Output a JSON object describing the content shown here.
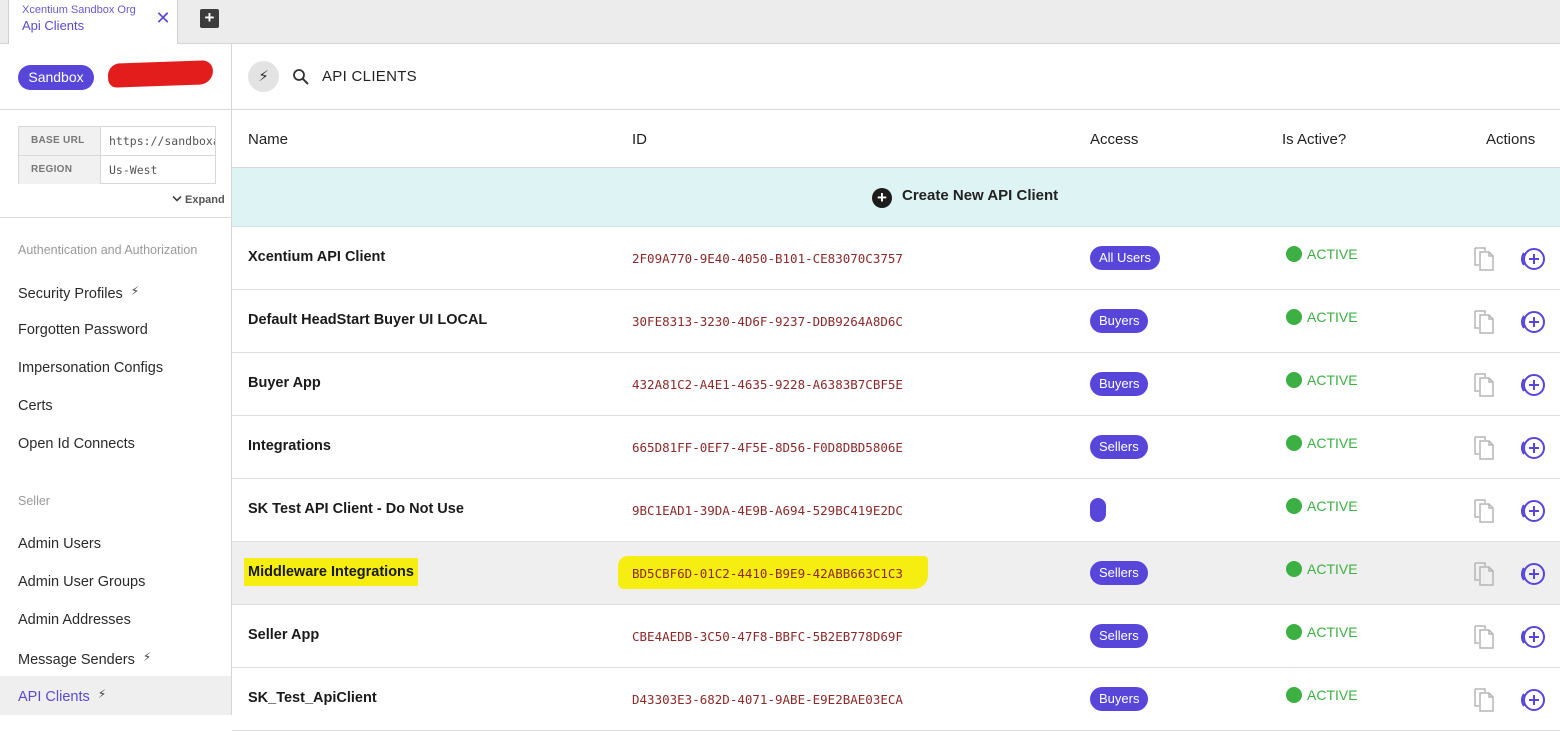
{
  "tab": {
    "org": "Xcentium Sandbox Org",
    "title": "Api Clients",
    "close_glyph": "✕",
    "add_glyph": "+"
  },
  "sidebar": {
    "env_badge": "Sandbox",
    "env": [
      {
        "key": "BASE URL",
        "value": "https://sandboxapi.ordercloud.io"
      },
      {
        "key": "REGION",
        "value": "Us-West"
      }
    ],
    "expand_label": "Expand",
    "sections": [
      {
        "label": "Authentication and Authorization",
        "items": [
          {
            "label": "Security Profiles",
            "bolt": true
          },
          {
            "label": "Forgotten Password",
            "bolt": false
          },
          {
            "label": "Impersonation Configs",
            "bolt": false
          },
          {
            "label": "Certs",
            "bolt": false
          },
          {
            "label": "Open Id Connects",
            "bolt": false
          }
        ]
      },
      {
        "label": "Seller",
        "items": [
          {
            "label": "Admin Users",
            "bolt": false
          },
          {
            "label": "Admin User Groups",
            "bolt": false
          },
          {
            "label": "Admin Addresses",
            "bolt": false
          },
          {
            "label": "Message Senders",
            "bolt": true
          },
          {
            "label": "API Clients",
            "bolt": true,
            "active": true
          }
        ]
      }
    ]
  },
  "header": {
    "title": "API CLIENTS",
    "bolt_glyph": "⚡"
  },
  "table": {
    "columns": [
      "Name",
      "ID",
      "Access",
      "Is Active?",
      "Actions"
    ],
    "create_label": "Create New API Client",
    "rows": [
      {
        "name": "Xcentium API Client",
        "id": "2F09A770-9E40-4050-B101-CE83070C3757",
        "access": "All Users",
        "status": "ACTIVE",
        "highlighted": false
      },
      {
        "name": "Default HeadStart Buyer UI LOCAL",
        "id": "30FE8313-3230-4D6F-9237-DDB9264A8D6C",
        "access": "Buyers",
        "status": "ACTIVE",
        "highlighted": false
      },
      {
        "name": "Buyer App",
        "id": "432A81C2-A4E1-4635-9228-A6383B7CBF5E",
        "access": "Buyers",
        "status": "ACTIVE",
        "highlighted": false
      },
      {
        "name": "Integrations",
        "id": "665D81FF-0EF7-4F5E-8D56-F0D8DBD5806E",
        "access": "Sellers",
        "status": "ACTIVE",
        "highlighted": false
      },
      {
        "name": "SK Test API Client - Do Not Use",
        "id": "9BC1EAD1-39DA-4E9B-A694-529BC419E2DC",
        "access": "",
        "status": "ACTIVE",
        "highlighted": false
      },
      {
        "name": "Middleware Integrations",
        "id": "BD5CBF6D-01C2-4410-B9E9-42ABB663C1C3",
        "access": "Sellers",
        "status": "ACTIVE",
        "highlighted": true
      },
      {
        "name": "Seller App",
        "id": "CBE4AEDB-3C50-47F8-BBFC-5B2EB778D69F",
        "access": "Sellers",
        "status": "ACTIVE",
        "highlighted": false
      },
      {
        "name": "SK_Test_ApiClient",
        "id": "D43303E3-682D-4071-9ABE-E9E2BAE03ECA",
        "access": "Buyers",
        "status": "ACTIVE",
        "highlighted": false
      }
    ]
  },
  "colors": {
    "accent": "#5746d9",
    "active": "#3cb043",
    "id_text": "#8b2a2a",
    "create_bg": "#def3f3",
    "highlight": "#f5ee10"
  },
  "icons": {
    "copy": "copy-icon",
    "add": "add-circle-icon",
    "search": "search-icon",
    "bolt": "bolt-icon"
  }
}
